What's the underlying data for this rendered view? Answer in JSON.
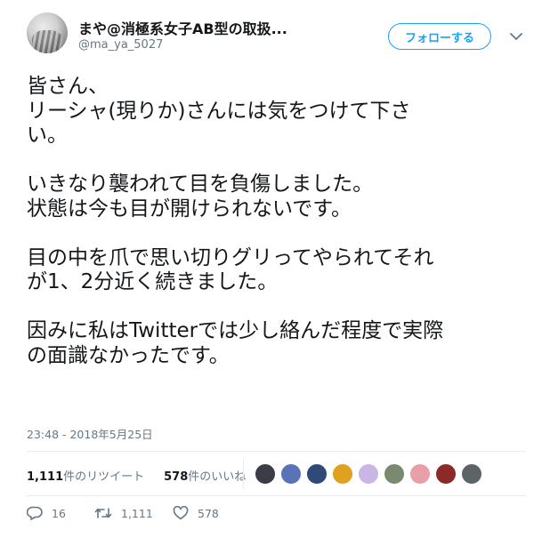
{
  "user": {
    "display_name": "まや@消極系女子AB型の取扱...",
    "handle": "@ma_ya_5027"
  },
  "header": {
    "follow_label": "フォローする"
  },
  "tweet": {
    "lines": [
      "皆さん、",
      "リーシャ(現りか)さんには気をつけて下さ",
      "い。",
      "",
      "いきなり襲われて目を負傷しました。",
      "状態は今も目が開けられないです。",
      "",
      "目の中を爪で思い切りグリってやられてそれ",
      "が1、2分近く続きました。",
      "",
      "因みに私はTwitterでは少し絡んだ程度で実際",
      "の面識なかったです。"
    ],
    "timestamp": "23:48 - 2018年5月25日"
  },
  "stats": {
    "retweet_count": "1,111",
    "retweet_label": "件のリツイート",
    "like_count": "578",
    "like_label": "件のいいね"
  },
  "likers": [
    {
      "icon": "avatar-1",
      "color": "#3c3c46"
    },
    {
      "icon": "avatar-2",
      "color": "#5a72b8"
    },
    {
      "icon": "avatar-3",
      "color": "#2f4a78"
    },
    {
      "icon": "avatar-4",
      "color": "#e0a020"
    },
    {
      "icon": "avatar-5",
      "color": "#c9b6e4"
    },
    {
      "icon": "avatar-6",
      "color": "#7a8a70"
    },
    {
      "icon": "avatar-7",
      "color": "#e8a0a8"
    },
    {
      "icon": "avatar-8",
      "color": "#8c2a2a"
    },
    {
      "icon": "avatar-9",
      "color": "#5c6468"
    }
  ],
  "actions": {
    "reply_count": "16",
    "retweet_count": "1,111",
    "like_count": "578"
  },
  "colors": {
    "accent": "#1da1f2",
    "muted": "#657786",
    "text": "#14171a"
  }
}
